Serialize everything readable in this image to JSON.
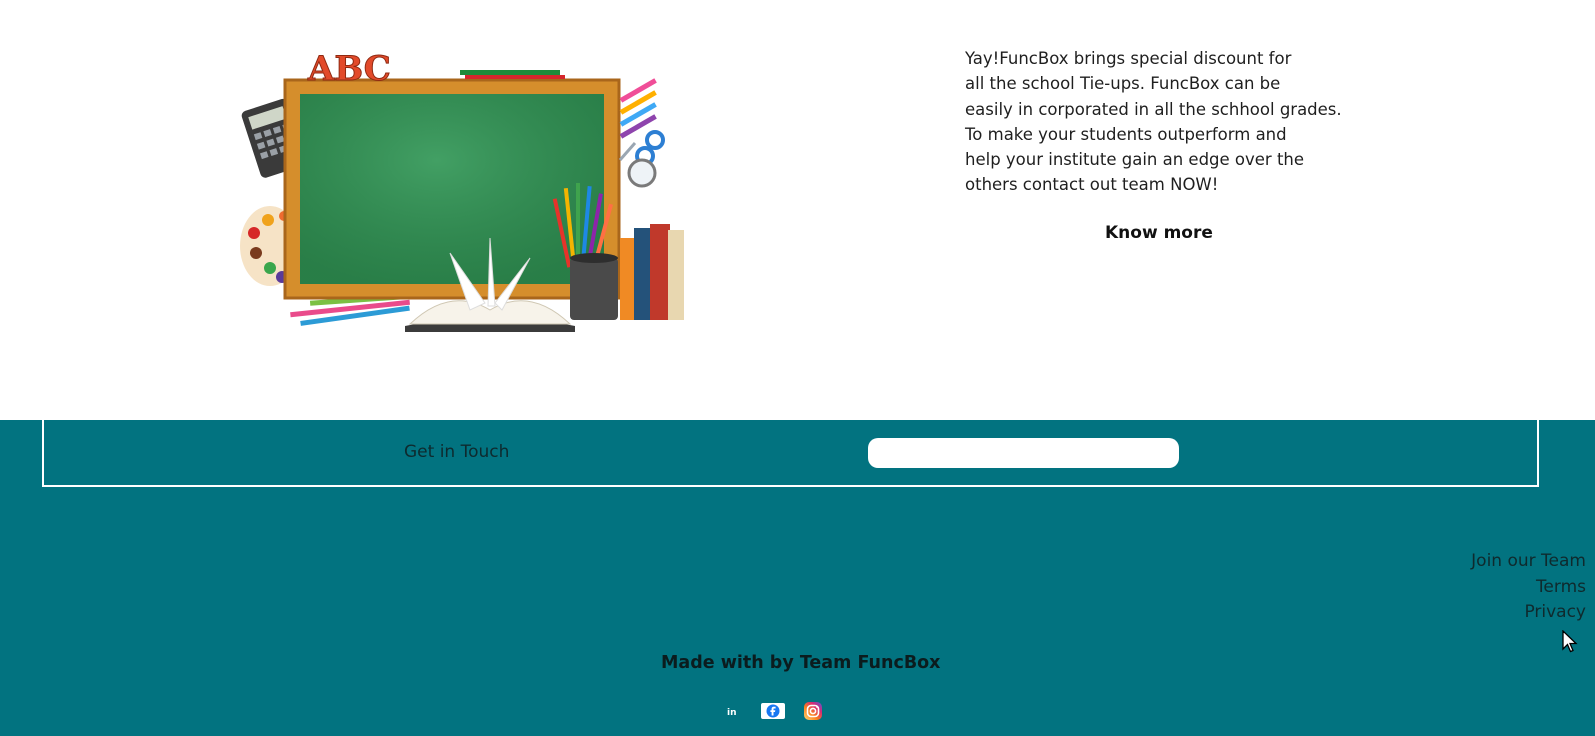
{
  "promo": {
    "lines": [
      "Yay!FuncBox brings special discount for",
      "all the school Tie-ups. FuncBox can be",
      "easily in corporated in all the schhool grades.",
      "To make your students outperform and",
      "help your institute gain an edge over the",
      "others contact out team NOW!"
    ],
    "cta_label": "Know more"
  },
  "illustration": {
    "abc_text": "ABC"
  },
  "footer": {
    "contact_label": "Get in Touch",
    "contact_input_placeholder": "",
    "links": [
      "Join our Team",
      "Terms",
      "Privacy"
    ],
    "made_with": "Made with by Team FuncBox",
    "socials": [
      "linkedin-icon",
      "facebook-icon",
      "instagram-icon"
    ],
    "background_color": "#027380"
  }
}
